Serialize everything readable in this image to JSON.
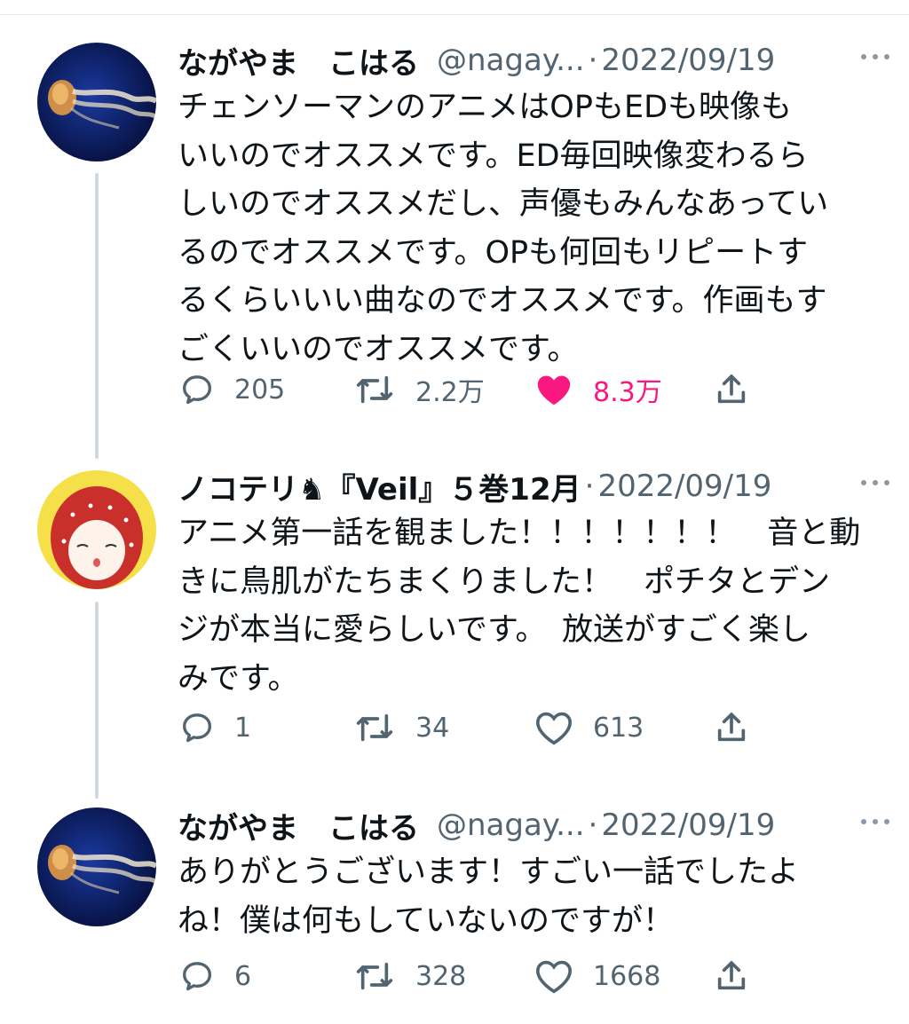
{
  "tweets": [
    {
      "name": "ながやま　こはる",
      "handle": "@nagay...",
      "separator": "·",
      "date": "2022/09/19",
      "lines": [
        "チェンソーマンのアニメはOPもEDも映像も",
        "いいのでオススメです。ED毎回映像変わるら",
        "しいのでオススメだし、声優もみんなあってい",
        "るのでオススメです。OPも何回もリピートす",
        "るくらいいい曲なのでオススメです。作画もす",
        "ごくいいのでオススメです。"
      ],
      "replies": "205",
      "retweets": "2.2万",
      "likes": "8.3万",
      "liked": true
    },
    {
      "name": "ノコテリ♞『Veil』５巻12月",
      "handle": "",
      "separator": "·",
      "date": "2022/09/19",
      "lines": [
        "アニメ第一話を観ました！！！！！！！　音と動",
        "きに鳥肌がたちまくりました！　ポチタとデン",
        "ジが本当に愛らしいです。　放送がすごく楽し",
        "みです。"
      ],
      "replies": "1",
      "retweets": "34",
      "likes": "613",
      "liked": false
    },
    {
      "name": "ながやま　こはる",
      "handle": "@nagay...",
      "separator": "·",
      "date": "2022/09/19",
      "lines": [
        "ありがとうございます！すごい一話でしたよ",
        "ね！僕は何もしていないのですが！"
      ],
      "replies": "6",
      "retweets": "328",
      "likes": "1668",
      "liked": false
    }
  ],
  "icons": {
    "reply": "reply-icon",
    "retweet": "retweet-icon",
    "like": "heart-icon",
    "share": "share-icon",
    "more": "more-icon"
  },
  "colors": {
    "text": "#0f1419",
    "secondary": "#536471",
    "like": "#f91880",
    "thread_line": "#cfd9de"
  }
}
